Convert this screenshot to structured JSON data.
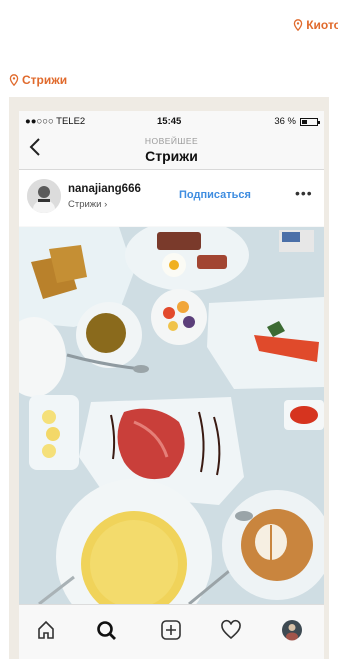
{
  "location_top": {
    "label": "Киото",
    "icon": "location-pin-icon"
  },
  "location_section": {
    "label": "Стрижи",
    "icon": "location-pin-icon"
  },
  "status_bar": {
    "carrier": "●●○○○ TELE2",
    "time": "15:45",
    "battery_label": "36 %",
    "battery_level": 0.36
  },
  "nav": {
    "back_icon": "chevron-left-icon",
    "subtitle": "НОВЕЙШЕЕ",
    "title": "Стрижи"
  },
  "post": {
    "username": "nanajiang666",
    "location": "Стрижи",
    "follow_label": "Подписаться",
    "more_icon": "more-options-icon",
    "photo": "breakfast-food-flatlay"
  },
  "tab_bar": [
    "home-icon",
    "search-icon",
    "add-post-icon",
    "heart-icon",
    "profile-avatar-icon"
  ],
  "colors": {
    "accent": "#e06a2c",
    "link": "#3f8de0",
    "frame": "#efebe4"
  }
}
